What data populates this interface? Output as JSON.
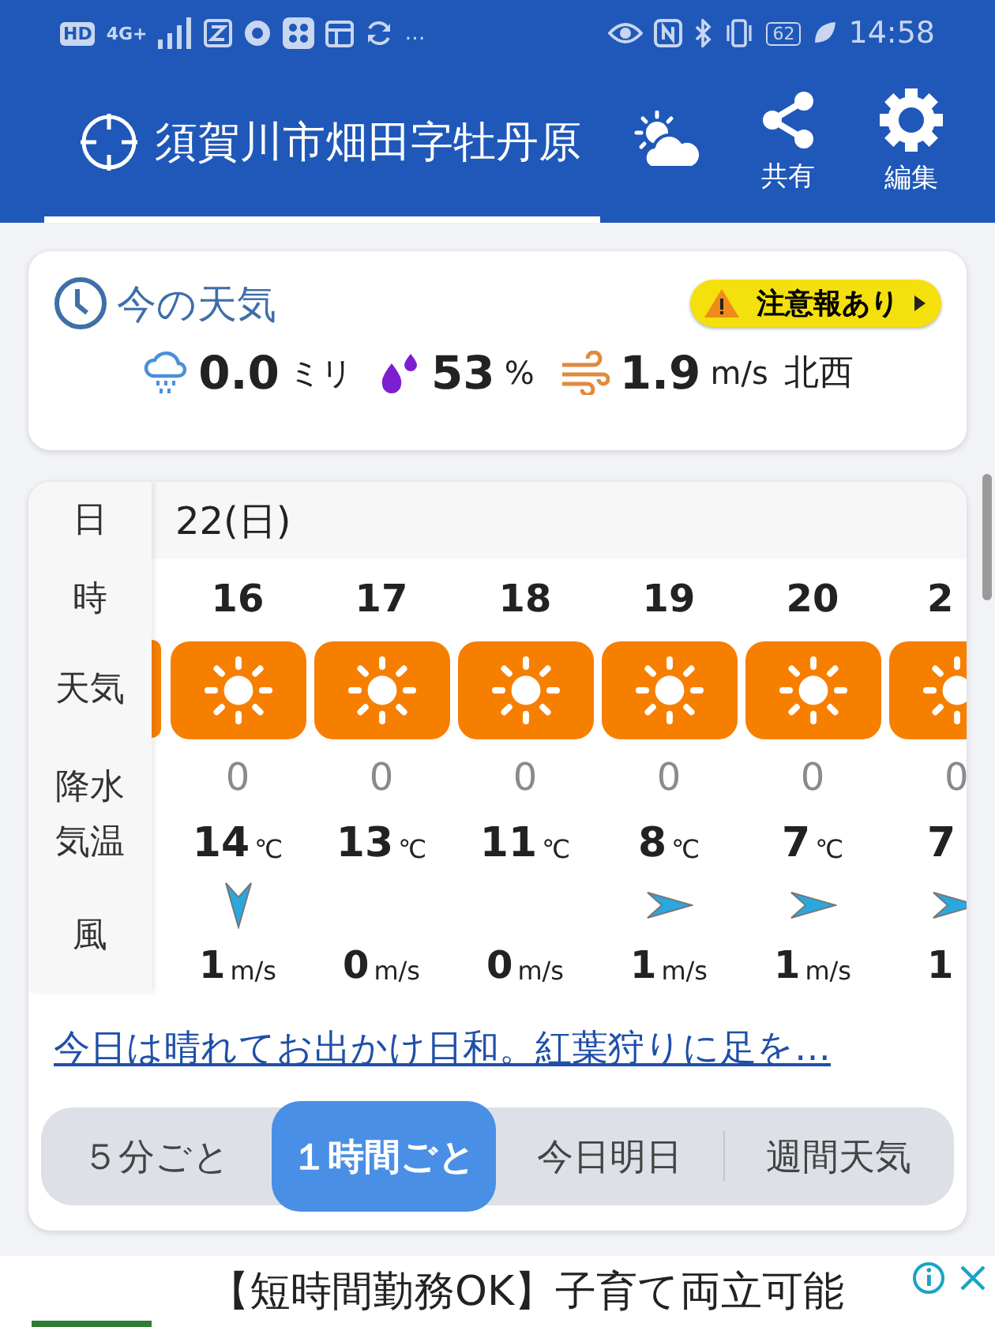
{
  "status_bar": {
    "badges": [
      "HD",
      "4G+"
    ],
    "more": "…",
    "battery": "62",
    "time": "14:58"
  },
  "header": {
    "location": "須賀川市畑田字牡丹原",
    "actions": [
      {
        "kind": "share",
        "label": "共有"
      },
      {
        "kind": "edit",
        "label": "編集"
      }
    ]
  },
  "current": {
    "title": "今の天気",
    "alert": "注意報あり",
    "precip": {
      "value": "0.0",
      "unit": "ミリ"
    },
    "humidity": {
      "value": "53",
      "unit": "%"
    },
    "wind": {
      "value": "1.9",
      "unit": "m/s",
      "direction": "北西"
    }
  },
  "hourly": {
    "labels": {
      "day": "日",
      "hour": "時",
      "weather": "天気",
      "precip": "降水",
      "temp": "気温",
      "wind": "風"
    },
    "date": "22(日)",
    "columns": [
      {
        "hour": "16",
        "weather": {
          "kind": "sunny"
        },
        "precip": "0",
        "temp": "14",
        "temp_unit": "℃",
        "wind_arrow": {
          "kind": "down"
        },
        "wind": "1",
        "wind_unit": "m/s",
        "cut_off": false
      },
      {
        "hour": "17",
        "weather": {
          "kind": "sunny"
        },
        "precip": "0",
        "temp": "13",
        "temp_unit": "℃",
        "wind": "0",
        "wind_unit": "m/s",
        "cut_off": false
      },
      {
        "hour": "18",
        "weather": {
          "kind": "sunny"
        },
        "precip": "0",
        "temp": "11",
        "temp_unit": "℃",
        "wind": "0",
        "wind_unit": "m/s",
        "cut_off": false
      },
      {
        "hour": "19",
        "weather": {
          "kind": "sunny"
        },
        "precip": "0",
        "temp": "8",
        "temp_unit": "℃",
        "wind_arrow": {
          "kind": "right"
        },
        "wind": "1",
        "wind_unit": "m/s",
        "cut_off": false
      },
      {
        "hour": "20",
        "weather": {
          "kind": "sunny"
        },
        "precip": "0",
        "temp": "7",
        "temp_unit": "℃",
        "wind_arrow": {
          "kind": "right"
        },
        "wind": "1",
        "wind_unit": "m/s",
        "cut_off": false
      },
      {
        "hour": "2",
        "weather": {
          "kind": "sunny"
        },
        "precip": "0",
        "temp": "7",
        "wind_arrow": {
          "kind": "right"
        },
        "wind": "1",
        "cut_off": true
      }
    ]
  },
  "summary_link": "今日は晴れてお出かけ日和。紅葉狩りに足を…",
  "view_tabs": [
    {
      "label": "５分ごと",
      "selected": false
    },
    {
      "label": "１時間ごと",
      "selected": true
    },
    {
      "label": "今日明日",
      "selected": false
    },
    {
      "label": "週間天気",
      "selected": false
    }
  ],
  "ad": {
    "text": "【短時間勤務OK】子育て両立可能"
  }
}
